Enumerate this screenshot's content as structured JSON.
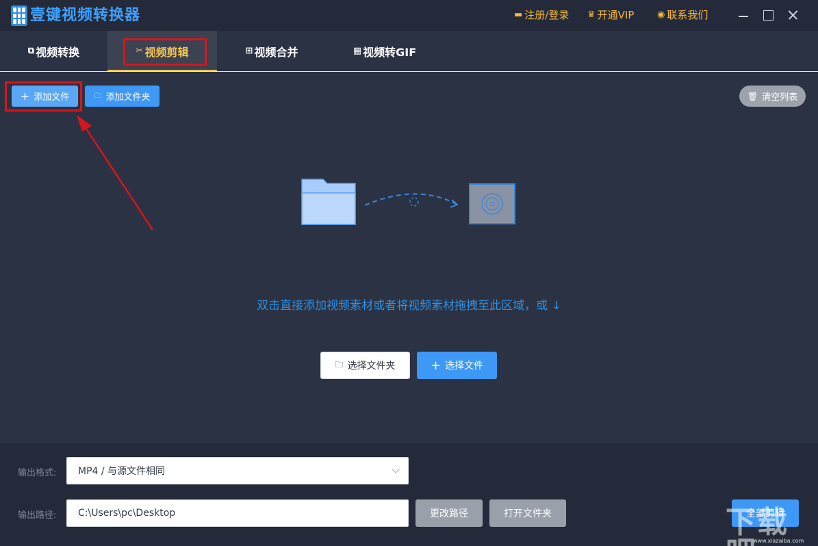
{
  "app": {
    "title": "壹键视频转换器"
  },
  "titlebar": {
    "register_label": "注册/登录",
    "vip_label": "开通VIP",
    "contact_label": "联系我们",
    "accent_color": "#f5b83d"
  },
  "tabs": [
    {
      "label": "视频转换",
      "icon": "convert-icon",
      "active": false
    },
    {
      "label": "视频剪辑",
      "icon": "cut-icon",
      "active": true
    },
    {
      "label": "视频合并",
      "icon": "merge-icon",
      "active": false
    },
    {
      "label": "视频转GIF",
      "icon": "gif-icon",
      "active": false
    }
  ],
  "toolbar": {
    "add_file_label": "添加文件",
    "add_folder_label": "添加文件夹",
    "clear_list_label": "清空列表"
  },
  "drop_area": {
    "hint": "双击直接添加视频素材或者将视频素材拖拽至此区域，或 ↓",
    "choose_folder_label": "选择文件夹",
    "choose_file_label": "选择文件"
  },
  "output": {
    "format_label": "输出格式:",
    "format_value": "MP4 / 与源文件相同",
    "path_label": "输出路径:",
    "path_value": "C:\\Users\\pc\\Desktop",
    "change_path_label": "更改路径",
    "open_folder_label": "打开文件夹",
    "start_label": "全部剪辑"
  },
  "watermark": {
    "main": "下载吧",
    "sub": "www.xiazaiba.com"
  },
  "colors": {
    "primary_blue": "#3e98f5",
    "highlight_red": "#d9151b",
    "active_tab": "#f3c455",
    "background": "#2b3243"
  }
}
